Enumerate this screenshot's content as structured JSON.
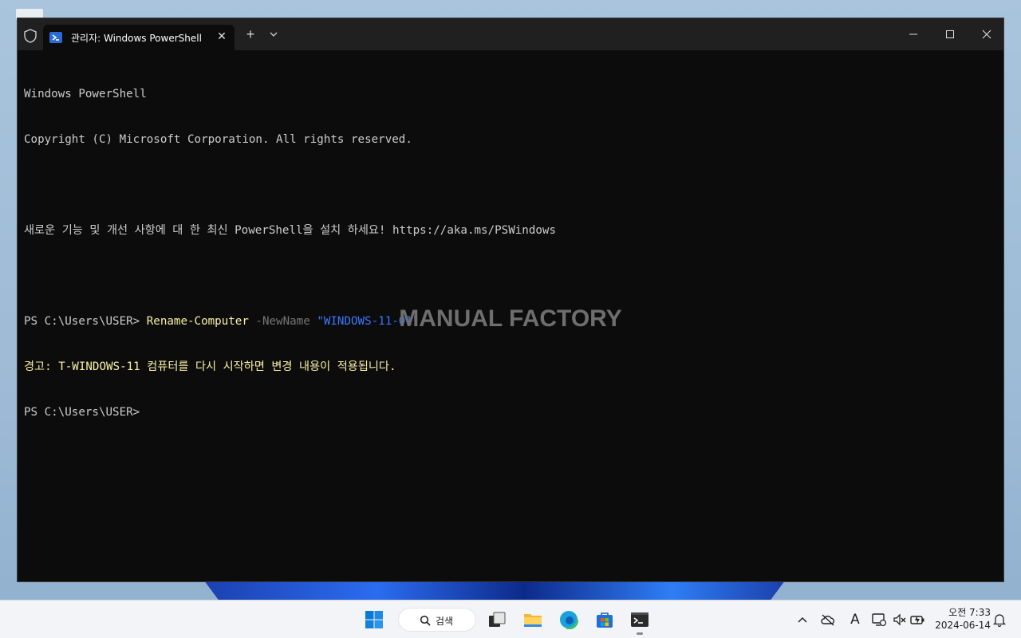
{
  "window": {
    "tab_title": "관리자: Windows PowerShell",
    "tab_close": "✕",
    "new_tab": "+"
  },
  "console": {
    "line1": "Windows PowerShell",
    "line2": "Copyright (C) Microsoft Corporation. All rights reserved.",
    "line4": "새로운 기능 및 개선 사항에 대 한 최신 PowerShell을 설치 하세요! https://aka.ms/PSWindows",
    "prompt1": "PS C:\\Users\\USER> ",
    "cmdlet": "Rename-Computer",
    "param": "-NewName",
    "arg": "\"WINDOWS-11-01\"",
    "warning": "경고: T-WINDOWS-11 컴퓨터를 다시 시작하면 변경 내용이 적용됩니다.",
    "prompt2": "PS C:\\Users\\USER>"
  },
  "watermark": "MANUAL FACTORY",
  "taskbar": {
    "search_label": "검색",
    "clock_time": "오전 7:33",
    "clock_date": "2024-06-14",
    "tray_lang": "A"
  },
  "colors": {
    "terminal_bg": "#0c0c0c",
    "titlebar_bg": "#202020",
    "cmdlet": "#f9f1a5",
    "param": "#767676",
    "string": "#3b78ff",
    "text": "#cccccc"
  }
}
